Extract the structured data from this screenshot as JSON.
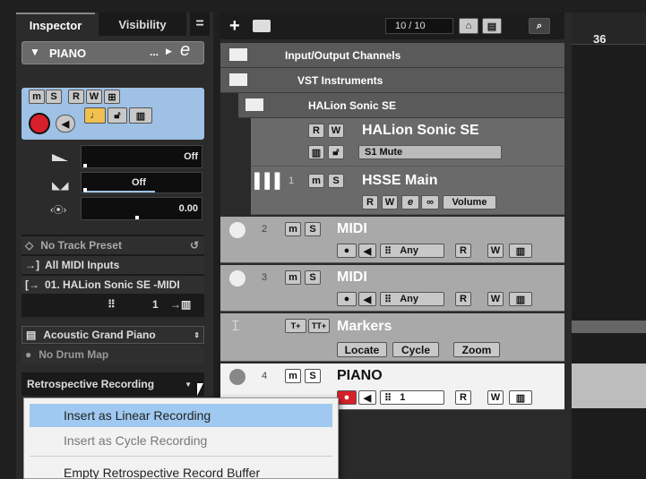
{
  "inspector": {
    "tab_inspector": "Inspector",
    "tab_visibility": "Visibility",
    "track_name": "PIANO",
    "more_label": "...",
    "volume_value": "Off",
    "pan_value": "Off",
    "delay_value": "0.00",
    "track_preset": "No Track Preset",
    "midi_input": "All MIDI Inputs",
    "midi_output": "01. HALion Sonic SE -MIDI",
    "midi_channel": "1",
    "program": "Acoustic Grand Piano",
    "drum_map": "No Drum Map",
    "retro_label": "Retrospective Recording"
  },
  "toolbar": {
    "counter": "10 / 10"
  },
  "ruler": {
    "bar": "36"
  },
  "tracks": {
    "io_channels": "Input/Output Channels",
    "vst_instruments": "VST Instruments",
    "halion_folder": "HALion Sonic SE",
    "halion_name": "HALion Sonic SE",
    "halion_mute": "S1 Mute",
    "hsse_number": "1",
    "hsse_name": "HSSE Main",
    "hsse_volume": "Volume",
    "midi2_number": "2",
    "midi2_name": "MIDI",
    "midi2_any": "Any",
    "midi3_number": "3",
    "midi3_name": "MIDI",
    "midi3_any": "Any",
    "markers_name": "Markers",
    "locate": "Locate",
    "cycle": "Cycle",
    "zoom": "Zoom",
    "piano_number": "4",
    "piano_name": "PIANO",
    "piano_channel": "1"
  },
  "buttons": {
    "m": "m",
    "s": "S",
    "r": "R",
    "w": "W"
  },
  "menu": {
    "items": [
      "Insert as Linear Recording",
      "Insert as Cycle Recording",
      "Empty Retrospective Record Buffer"
    ]
  },
  "colors": {
    "highlight": "#9fc9f0",
    "record": "#d6202a",
    "bg_dark": "#1f1f1f"
  }
}
